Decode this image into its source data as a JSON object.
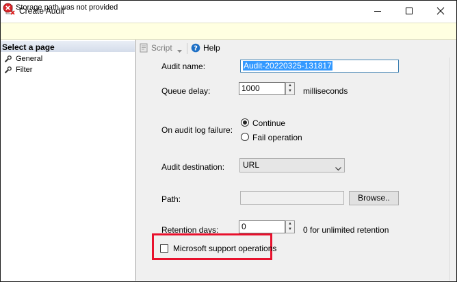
{
  "window": {
    "title": "Create Audit",
    "minimize_icon": "minimize-icon",
    "maximize_icon": "maximize-icon",
    "close_icon": "close-icon"
  },
  "error_bar": {
    "message": "Storage path was not provided",
    "icon": "error-icon",
    "color": "#ffffe1"
  },
  "left_pane": {
    "header": "Select a page",
    "items": [
      {
        "label": "General",
        "icon": "wrench-icon"
      },
      {
        "label": "Filter",
        "icon": "wrench-icon"
      }
    ]
  },
  "toolbar": {
    "script_label": "Script",
    "help_label": "Help"
  },
  "form": {
    "audit_name_label": "Audit name:",
    "audit_name_value": "Audit-20220325-131817",
    "queue_delay_label": "Queue delay:",
    "queue_delay_value": "1000",
    "queue_delay_unit": "milliseconds",
    "failure_label": "On audit log failure:",
    "failure_options": [
      {
        "label": "Continue",
        "selected": true
      },
      {
        "label": "Fail operation",
        "selected": false
      }
    ],
    "destination_label": "Audit destination:",
    "destination_value": "URL",
    "path_label": "Path:",
    "path_value": "",
    "browse_label": "Browse..",
    "retention_label": "Retention days:",
    "retention_value": "0",
    "retention_hint": "0 for unlimited retention",
    "ms_support_label": "Microsoft support operations",
    "ms_support_checked": false
  },
  "highlight_color": "#e8112d"
}
